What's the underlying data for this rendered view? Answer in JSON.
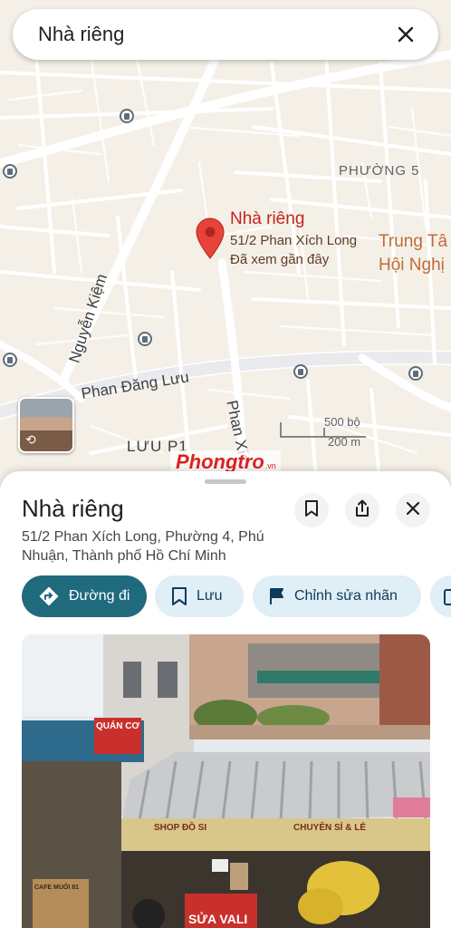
{
  "search": {
    "query": "Nhà riêng",
    "close_icon": "close-icon"
  },
  "map": {
    "district_label": "PHƯỜNG 5",
    "ward_label": "LƯU P1",
    "streets": {
      "nguyen_kiem": "Nguyễn Kiệm",
      "phan_dang_luu": "Phan Đăng Lưu",
      "phan_xich": "Phan Xíc"
    },
    "poi": {
      "line1": "Trung Tâ",
      "line2": "Hội Nghị"
    },
    "place": {
      "name": "Nhà riêng",
      "address": "51/2 Phan Xích Long",
      "note": "Đã xem gần đây"
    },
    "scale": {
      "feet": "500 bộ",
      "meters": "200 m"
    },
    "watermark": {
      "main": "Phongtro",
      "sub": ".vn"
    }
  },
  "sheet": {
    "title": "Nhà riêng",
    "address": "51/2 Phan Xích Long, Phường 4, Phú Nhuận, Thành phố Hồ Chí Minh",
    "chips": [
      {
        "label": "Đường đi",
        "icon": "directions-icon"
      },
      {
        "label": "Lưu",
        "icon": "bookmark-icon"
      },
      {
        "label": "Chỉnh sửa nhãn",
        "icon": "flag-icon"
      }
    ],
    "photo_signs": {
      "shop1": "QUÁN CƠ",
      "shop2": "SHOP ĐỒ SI",
      "shop3": "CHUYÊN SỈ & LẺ",
      "shop4": "SỬA VALI",
      "shop5": "CAFE MUỐI 81"
    }
  },
  "colors": {
    "primary_chip": "#1f6a7d",
    "chip_bg": "#e0eef6",
    "pin": "#e8433a",
    "place_name": "#c5221f"
  }
}
